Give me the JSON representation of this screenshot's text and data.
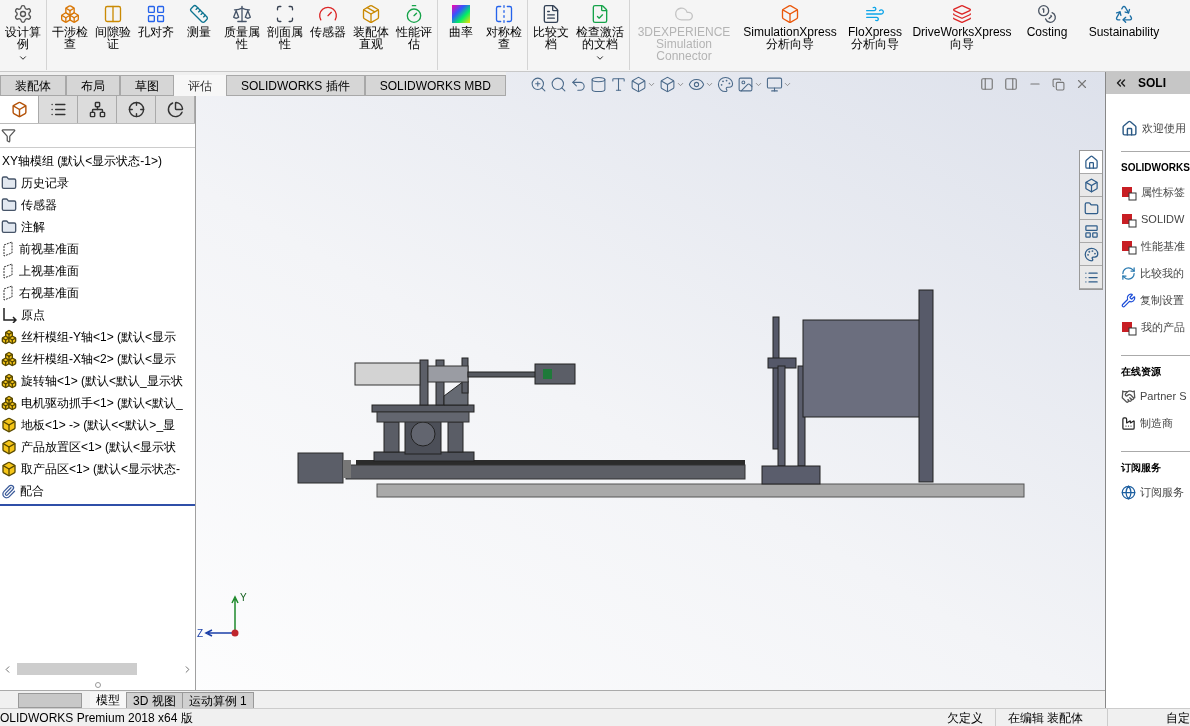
{
  "ribbon": {
    "tool_groups": [
      [
        {
          "label": "设计算例",
          "disabled": false,
          "has_menu": true
        }
      ],
      [
        {
          "label": "干涉检查",
          "disabled": false,
          "has_menu": false
        },
        {
          "label": "间隙验证",
          "disabled": false,
          "has_menu": false
        },
        {
          "label": "孔对齐",
          "disabled": false,
          "has_menu": false
        },
        {
          "label": "测量",
          "disabled": false,
          "has_menu": false
        },
        {
          "label": "质量属性",
          "disabled": false,
          "has_menu": false
        },
        {
          "label": "剖面属性",
          "disabled": false,
          "has_menu": false
        },
        {
          "label": "传感器",
          "disabled": false,
          "has_menu": false
        },
        {
          "label": "装配体直观",
          "disabled": false,
          "has_menu": false
        },
        {
          "label": "性能评估",
          "disabled": false,
          "has_menu": false
        }
      ],
      [
        {
          "label": "曲率",
          "disabled": false,
          "has_menu": false
        },
        {
          "label": "对称检查",
          "disabled": false,
          "has_menu": false
        }
      ],
      [
        {
          "label": "比较文档",
          "disabled": false,
          "has_menu": false
        },
        {
          "label": "检查激活的文档",
          "disabled": false,
          "has_menu": true
        }
      ],
      [
        {
          "label": "3DEXPERIENCE Simulation Connector",
          "disabled": true,
          "has_menu": false
        },
        {
          "label": "SimulationXpress 分析向导",
          "disabled": false,
          "has_menu": false
        },
        {
          "label": "FloXpress 分析向导",
          "disabled": false,
          "has_menu": false
        },
        {
          "label": "DriveWorksXpress 向导",
          "disabled": false,
          "has_menu": false
        },
        {
          "label": "Costing",
          "disabled": false,
          "has_menu": false
        },
        {
          "label": "Sustainability",
          "disabled": false,
          "has_menu": false
        }
      ]
    ]
  },
  "command_tabs": [
    {
      "label": "装配体",
      "selected": false
    },
    {
      "label": "布局",
      "selected": false
    },
    {
      "label": "草图",
      "selected": false
    },
    {
      "label": "评估",
      "selected": true
    },
    {
      "label": "SOLIDWORKS 插件",
      "selected": false
    },
    {
      "label": "SOLIDWORKS MBD",
      "selected": false
    }
  ],
  "manager_tabs": [
    {
      "selected": true
    },
    {
      "selected": false
    },
    {
      "selected": false
    },
    {
      "selected": false
    },
    {
      "selected": false
    }
  ],
  "feature_tree": {
    "root": "XY轴模组  (默认<显示状态-1>)",
    "items": [
      {
        "kind": "history",
        "label": "历史记录"
      },
      {
        "kind": "sensor",
        "label": "传感器"
      },
      {
        "kind": "annotation",
        "label": "注解"
      },
      {
        "kind": "plane",
        "label": "前视基准面"
      },
      {
        "kind": "plane",
        "label": "上视基准面"
      },
      {
        "kind": "plane",
        "label": "右视基准面"
      },
      {
        "kind": "origin",
        "label": "原点"
      },
      {
        "kind": "subassembly",
        "label": "丝杆模组-Y轴<1>  (默认<显示"
      },
      {
        "kind": "subassembly",
        "label": "丝杆模组-X轴<2>  (默认<显示"
      },
      {
        "kind": "subassembly",
        "label": "旋转轴<1>  (默认<默认_显示状"
      },
      {
        "kind": "subassembly",
        "label": "电机驱动抓手<1>  (默认<默认_"
      },
      {
        "kind": "part",
        "label": "地板<1>  ->  (默认<<默认>_显"
      },
      {
        "kind": "part",
        "label": "产品放置区<1>  (默认<显示状"
      },
      {
        "kind": "part",
        "label": "取产品区<1>  (默认<显示状态-"
      },
      {
        "kind": "mate",
        "label": "配合"
      }
    ]
  },
  "side_tabs": [
    {
      "selected": true
    },
    {
      "selected": false
    },
    {
      "selected": false
    },
    {
      "selected": false
    },
    {
      "selected": false
    },
    {
      "selected": false
    }
  ],
  "triad": {
    "y": "Y",
    "z": "Z"
  },
  "bottom_tabs": [
    {
      "label": "模型",
      "selected": true
    },
    {
      "label": "3D 视图",
      "selected": false
    },
    {
      "label": "运动算例 1",
      "selected": false
    }
  ],
  "task_pane": {
    "title": "SOLI",
    "welcome": "欢迎使用",
    "sections": [
      {
        "title": "SOLIDWORKS",
        "items": [
          {
            "kind": "sw-doc",
            "label": "属性标签"
          },
          {
            "kind": "sw-rx",
            "label": "SOLIDW"
          },
          {
            "kind": "sw-rx",
            "label": "性能基准"
          },
          {
            "kind": "compare",
            "label": "比较我的"
          },
          {
            "kind": "copy",
            "label": "复制设置"
          },
          {
            "kind": "product",
            "label": "我的产品"
          }
        ]
      },
      {
        "title": "在线资源",
        "items": [
          {
            "kind": "partner",
            "label": "Partner S"
          },
          {
            "kind": "factory",
            "label": "制造商"
          }
        ]
      },
      {
        "title": "订阅服务",
        "items": [
          {
            "kind": "globe",
            "label": "订阅服务"
          }
        ]
      }
    ]
  },
  "status_bar": {
    "product": "OLIDWORKS Premium 2018 x64 版",
    "state": "欠定义",
    "mode": "在编辑 装配体",
    "units": "自定"
  }
}
